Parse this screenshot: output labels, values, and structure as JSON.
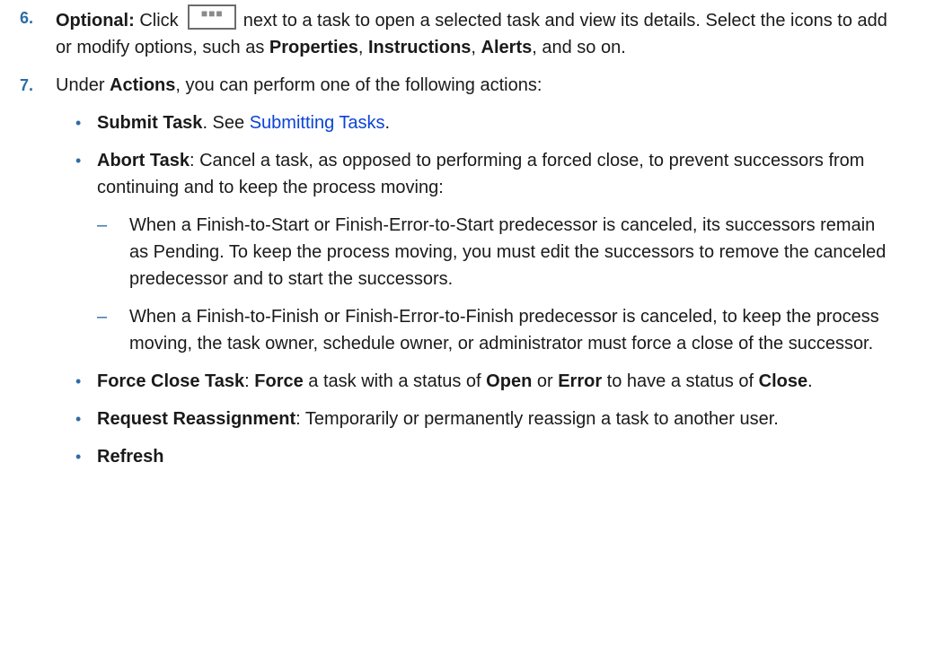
{
  "step6": {
    "number": "6.",
    "optional": "Optional:",
    "click": " Click ",
    "button_icon": "more-options-icon",
    "after_button": " next to a task to open a selected task and view its details. Select the icons to add or modify options, such as ",
    "properties": "Properties",
    "comma1": ", ",
    "instructions": "Instructions",
    "comma2": ", ",
    "alerts": "Alerts",
    "tail": ", and so on."
  },
  "step7": {
    "number": "7.",
    "under": "Under ",
    "actions": "Actions",
    "intro": ", you can perform one of the following actions:",
    "bullet_mark": "•",
    "submit": {
      "label": "Submit Task",
      "text": ". See ",
      "link": "Submitting Tasks",
      "end": "."
    },
    "abort": {
      "label": "Abort Task",
      "text": ": Cancel a task, as opposed to performing a forced close, to prevent successors from continuing and to keep the process moving:",
      "dash_mark": "–",
      "sub1": "When a Finish-to-Start or Finish-Error-to-Start predecessor is canceled, its successors remain as Pending. To keep the process moving, you must edit the successors to remove the canceled predecessor and to start the successors.",
      "sub2": "When a Finish-to-Finish or Finish-Error-to-Finish predecessor is canceled, to keep the process moving, the task owner, schedule owner, or administrator must force a close of the successor."
    },
    "force": {
      "label": "Force Close Task",
      "colon": ": ",
      "force_word": "Force",
      "text1": " a task with a status of ",
      "open": "Open",
      "or": " or ",
      "error": "Error",
      "text2": " to have a status of ",
      "close": "Close",
      "end": "."
    },
    "reassign": {
      "label": "Request Reassignment",
      "text": ": Temporarily or permanently reassign a task to another user."
    },
    "refresh": {
      "label": "Refresh"
    }
  }
}
